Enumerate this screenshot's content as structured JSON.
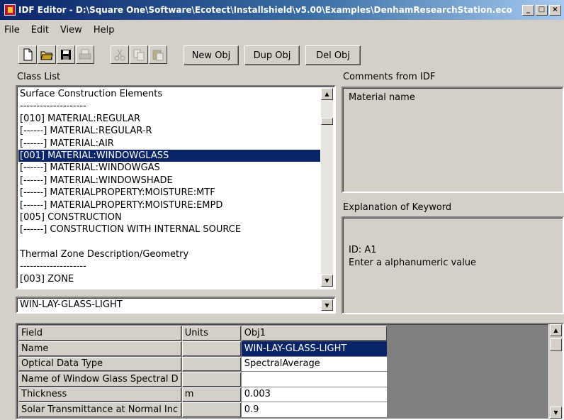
{
  "window": {
    "title": "IDF Editor - D:\\Square One\\Software\\Ecotect\\Installshield\\v5.00\\Examples\\DenhamResearchStation.eco",
    "controls": {
      "minimize": "_",
      "maximize": "□",
      "close": "×"
    }
  },
  "menu": {
    "file": "File",
    "edit": "Edit",
    "view": "View",
    "help": "Help"
  },
  "toolbar": {
    "icons": [
      "new-file-icon",
      "open-folder-icon",
      "save-disk-icon",
      "print-icon",
      "cut-icon",
      "copy-icon",
      "paste-icon"
    ],
    "new_obj": "New Obj",
    "dup_obj": "Dup Obj",
    "del_obj": "Del Obj"
  },
  "class_list": {
    "label": "Class List",
    "rows": [
      "Surface Construction Elements",
      "--------------------",
      "[010] MATERIAL:REGULAR",
      "[------] MATERIAL:REGULAR-R",
      "[------] MATERIAL:AIR",
      "[001] MATERIAL:WINDOWGLASS",
      "[------] MATERIAL:WINDOWGAS",
      "[------] MATERIAL:WINDOWSHADE",
      "[------] MATERIALPROPERTY:MOISTURE:MTF",
      "[------] MATERIALPROPERTY:MOISTURE:EMPD",
      "[005] CONSTRUCTION",
      "[------] CONSTRUCTION WITH INTERNAL SOURCE",
      "",
      "Thermal Zone Description/Geometry",
      "--------------------",
      "[003] ZONE"
    ],
    "selected_index": 5
  },
  "object_combo": {
    "value": "WIN-LAY-GLASS-LIGHT"
  },
  "comments": {
    "label": "Comments from IDF",
    "text": "Material name"
  },
  "explanation": {
    "label": "Explanation of Keyword",
    "id_line": "ID: A1",
    "desc_line": "Enter a alphanumeric value"
  },
  "grid": {
    "headers": [
      "Field",
      "Units",
      "Obj1"
    ],
    "rows": [
      {
        "field": "Name",
        "units": "",
        "value": "WIN-LAY-GLASS-LIGHT"
      },
      {
        "field": "Optical Data Type",
        "units": "",
        "value": "SpectralAverage"
      },
      {
        "field": "Name of Window Glass Spectral D",
        "units": "",
        "value": ""
      },
      {
        "field": "Thickness",
        "units": "m",
        "value": "0.003"
      },
      {
        "field": "Solar Transmittance at Normal Inc",
        "units": "",
        "value": "0.9"
      }
    ],
    "selected_row": 0
  }
}
